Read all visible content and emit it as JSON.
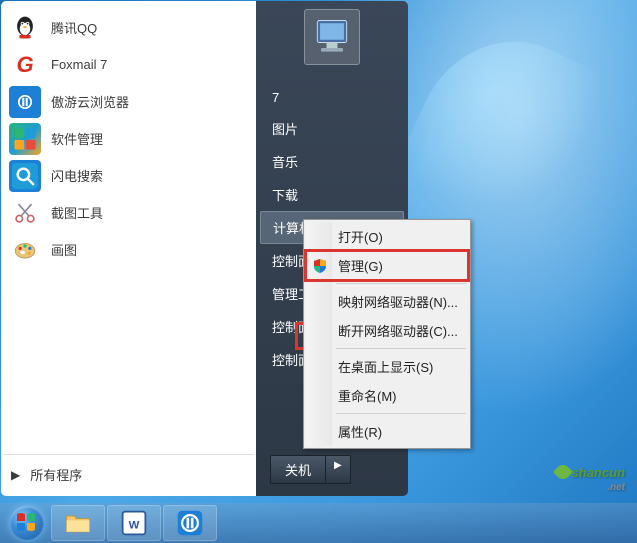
{
  "programs": [
    {
      "label": "腾讯QQ",
      "icon": "qq-icon"
    },
    {
      "label": "Foxmail 7",
      "icon": "foxmail-icon"
    },
    {
      "label": "傲游云浏览器",
      "icon": "maxthon-icon"
    },
    {
      "label": "软件管理",
      "icon": "software-mgr-icon"
    },
    {
      "label": "闪电搜索",
      "icon": "search-app-icon"
    },
    {
      "label": "截图工具",
      "icon": "snipping-icon"
    },
    {
      "label": "画图",
      "icon": "paint-icon"
    }
  ],
  "all_programs_label": "所有程序",
  "right_items": [
    {
      "label": "7"
    },
    {
      "label": "图片"
    },
    {
      "label": "音乐"
    },
    {
      "label": "下载"
    },
    {
      "label": "计算机",
      "highlighted": true
    },
    {
      "label": "控制面板"
    },
    {
      "label": "管理工具"
    },
    {
      "label": "控制面板\\桌面"
    },
    {
      "label": "控制面板\\显示(S)"
    }
  ],
  "shutdown_label": "关机",
  "context_menu": [
    {
      "label": "打开(O)"
    },
    {
      "label": "管理(G)",
      "shield": true,
      "highlighted": true
    },
    {
      "sep": true
    },
    {
      "label": "映射网络驱动器(N)..."
    },
    {
      "label": "断开网络驱动器(C)..."
    },
    {
      "sep": true
    },
    {
      "label": "在桌面上显示(S)"
    },
    {
      "label": "重命名(M)"
    },
    {
      "sep": true
    },
    {
      "label": "属性(R)"
    }
  ],
  "watermark": {
    "main": "shancun",
    "sub": ".net"
  }
}
